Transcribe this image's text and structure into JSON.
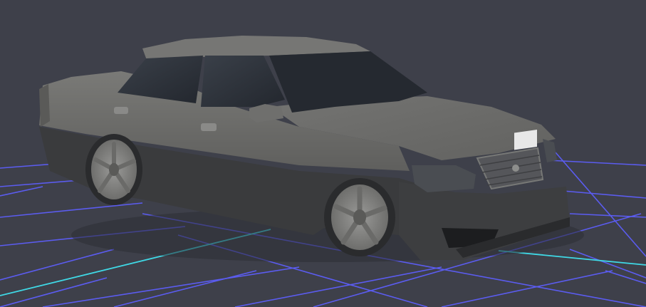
{
  "scene": {
    "background_color": "#3e404a",
    "grid_line_color": "#5b5cf0",
    "grid_axis_color": "#3fd9e6",
    "subject": "car-model"
  },
  "car": {
    "body_color": "#6b6b69",
    "lower_body_color": "#3a3b3d",
    "window_color": "#2b2f36",
    "wheel_color": "#8c8c8a",
    "grille_color": "#55565a",
    "plate_color": "#e8e8e8"
  }
}
